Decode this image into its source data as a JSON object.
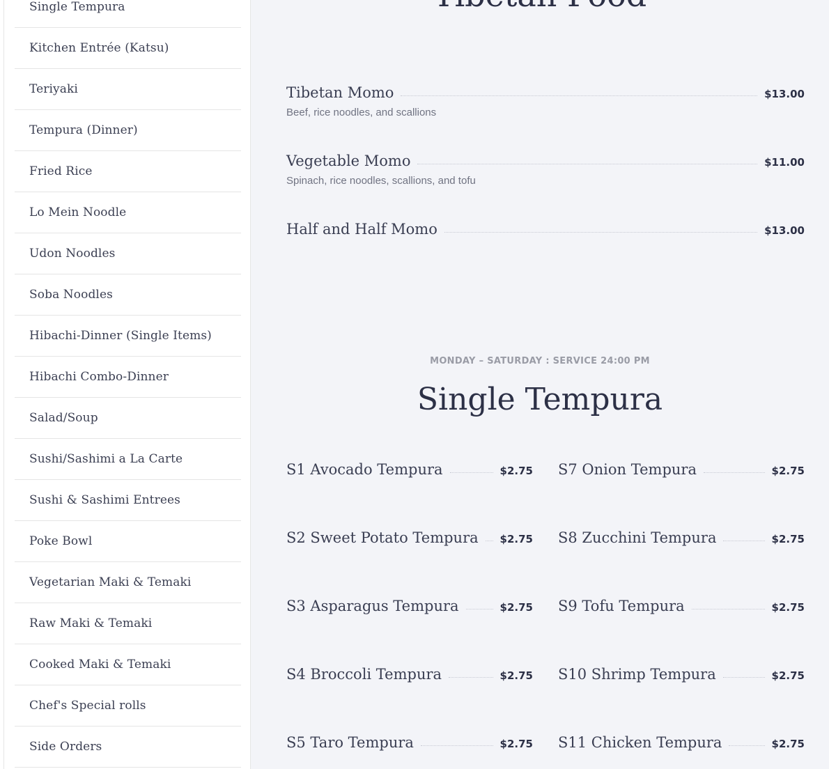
{
  "sidebar": {
    "items": [
      "Single Tempura",
      "Kitchen Entrée (Katsu)",
      "Teriyaki",
      "Tempura (Dinner)",
      "Fried Rice",
      "Lo Mein Noodle",
      "Udon Noodles",
      "Soba Noodles",
      "Hibachi-Dinner (Single Items)",
      "Hibachi Combo-Dinner",
      "Salad/Soup",
      "Sushi/Sashimi a La Carte",
      "Sushi & Sashimi Entrees",
      "Poke Bowl",
      "Vegetarian Maki & Temaki",
      "Raw Maki & Temaki",
      "Cooked Maki & Temaki",
      "Chef's Special rolls",
      "Side Orders"
    ]
  },
  "tibetan": {
    "title": "Tibetan Food",
    "items": [
      {
        "name": "Tibetan Momo",
        "price": "$13.00",
        "desc": "Beef, rice noodles, and scallions"
      },
      {
        "name": "Vegetable Momo",
        "price": "$11.00",
        "desc": "Spinach, rice noodles, scallions, and tofu"
      },
      {
        "name": "Half and Half Momo",
        "price": "$13.00",
        "desc": ""
      }
    ]
  },
  "tempura": {
    "service": "MONDAY – SATURDAY : SERVICE 24:00 PM",
    "title": "Single Tempura",
    "left": [
      {
        "name": "S1 Avocado Tempura",
        "price": "$2.75"
      },
      {
        "name": "S2 Sweet Potato Tempura",
        "price": "$2.75"
      },
      {
        "name": "S3 Asparagus Tempura",
        "price": "$2.75"
      },
      {
        "name": "S4 Broccoli Tempura",
        "price": "$2.75"
      },
      {
        "name": "S5 Taro Tempura",
        "price": "$2.75"
      }
    ],
    "right": [
      {
        "name": "S7 Onion Tempura",
        "price": "$2.75"
      },
      {
        "name": "S8 Zucchini Tempura",
        "price": "$2.75"
      },
      {
        "name": "S9 Tofu Tempura",
        "price": "$2.75"
      },
      {
        "name": "S10 Shrimp Tempura",
        "price": "$2.75"
      },
      {
        "name": "S11 Chicken Tempura",
        "price": "$2.75"
      }
    ]
  }
}
